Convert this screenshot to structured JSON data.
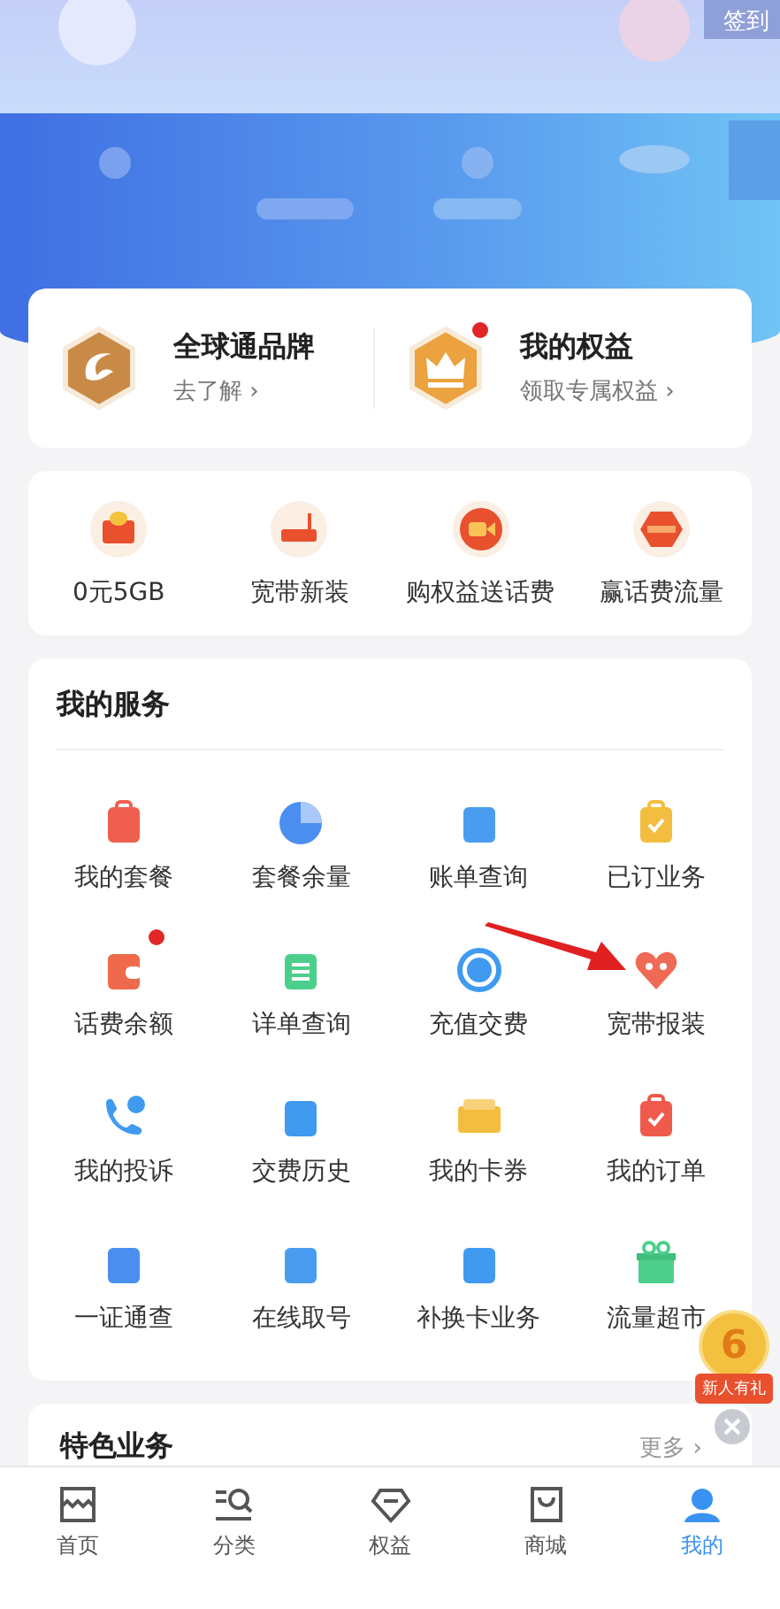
{
  "header": {
    "kind": "picture",
    "sign_in": "签到"
  },
  "brand_cards": [
    {
      "title": "全球通品牌",
      "link": "去了解 ›",
      "badge_dot": false
    },
    {
      "title": "我的权益",
      "link": "领取专属权益 ›",
      "badge_dot": true
    }
  ],
  "promos": [
    {
      "label": "0元5GB"
    },
    {
      "label": "宽带新装"
    },
    {
      "label": "购权益送话费"
    },
    {
      "label": "赢话费流量"
    }
  ],
  "my_services": {
    "title": "我的服务",
    "items": [
      {
        "label": "我的套餐",
        "badge_dot": false
      },
      {
        "label": "套餐余量",
        "badge_dot": false
      },
      {
        "label": "账单查询",
        "badge_dot": false
      },
      {
        "label": "已订业务",
        "badge_dot": false
      },
      {
        "label": "话费余额",
        "badge_dot": true
      },
      {
        "label": "详单查询",
        "badge_dot": false
      },
      {
        "label": "充值交费",
        "badge_dot": false
      },
      {
        "label": "宽带报装",
        "badge_dot": false
      },
      {
        "label": "我的投诉",
        "badge_dot": false
      },
      {
        "label": "交费历史",
        "badge_dot": false
      },
      {
        "label": "我的卡券",
        "badge_dot": false
      },
      {
        "label": "我的订单",
        "badge_dot": false
      },
      {
        "label": "一证通查",
        "badge_dot": false
      },
      {
        "label": "在线取号",
        "badge_dot": false
      },
      {
        "label": "补换卡业务",
        "badge_dot": false
      },
      {
        "label": "流量超市",
        "badge_dot": false
      }
    ]
  },
  "featured": {
    "title": "特色业务",
    "more": "更多 ›"
  },
  "floating_promo": {
    "amount": "6",
    "label": "新人有礼"
  },
  "tabs": [
    {
      "label": "首页",
      "selected": false
    },
    {
      "label": "分类",
      "selected": false
    },
    {
      "label": "权益",
      "selected": false
    },
    {
      "label": "商城",
      "selected": false
    },
    {
      "label": "我的",
      "selected": true
    }
  ]
}
